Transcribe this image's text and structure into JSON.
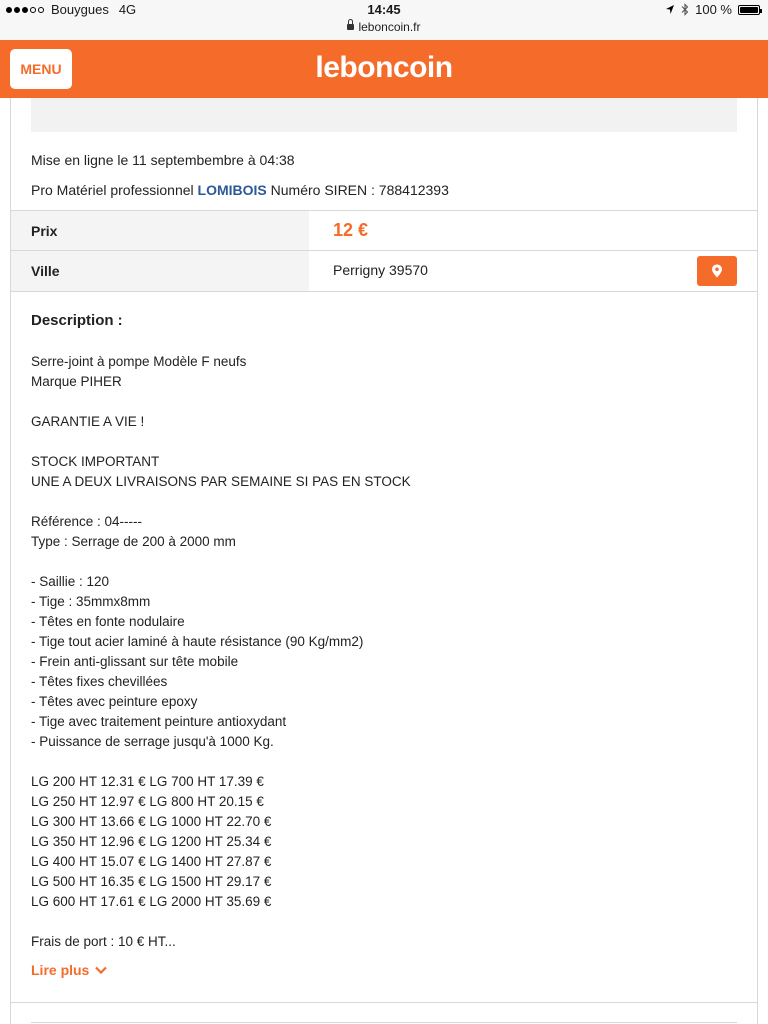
{
  "status_bar": {
    "carrier": "Bouygues",
    "network": "4G",
    "time": "14:45",
    "url": "leboncoin.fr",
    "battery": "100 %"
  },
  "header": {
    "menu_label": "MENU",
    "logo_text": "leboncoin"
  },
  "listing": {
    "posted": "Mise en ligne le 11 septembembre à 04:38",
    "seller_prefix": "Pro Matériel professionnel",
    "seller_name": "LOMIBOIS",
    "siren": "Numéro SIREN : 788412393",
    "price_label": "Prix",
    "price_value": "12 €",
    "city_label": "Ville",
    "city_value": "Perrigny 39570",
    "description_title": "Description :",
    "description_lines": [
      "Serre-joint à pompe Modèle F neufs",
      "Marque PIHER",
      "",
      "GARANTIE A VIE !",
      "",
      "STOCK IMPORTANT",
      "UNE A DEUX LIVRAISONS PAR SEMAINE SI PAS EN STOCK",
      "",
      "Référence : 04-----",
      "Type : Serrage de 200 à 2000 mm",
      "",
      "- Saillie : 120",
      "- Tige : 35mmx8mm",
      "- Têtes en fonte nodulaire",
      "- Tige tout acier laminé à haute résistance (90 Kg/mm2)",
      "- Frein anti-glissant sur tête mobile",
      "- Têtes fixes chevillées",
      "- Têtes avec peinture epoxy",
      "- Tige avec traitement peinture antioxydant",
      "- Puissance de serrage jusqu'à 1000 Kg.",
      "",
      "LG 200 HT 12.31 € LG 700 HT 17.39 €",
      "LG 250 HT 12.97 € LG 800 HT 20.15 €",
      "LG 300 HT 13.66 € LG 1000 HT 22.70 €",
      "LG 350 HT 12.96 € LG 1200 HT 25.34 €",
      "LG 400 HT 15.07 € LG 1400 HT 27.87 €",
      "LG 500 HT 16.35 € LG 1500 HT 29.17 €",
      "LG 600 HT 17.61 € LG 2000 HT 35.69 €",
      "",
      "Frais de port : 10 € HT..."
    ],
    "read_more": "Lire plus"
  },
  "colors": {
    "brand_orange": "#f56b2a",
    "link_blue": "#2b5a95"
  },
  "icons": [
    "location-arrow-icon",
    "bluetooth-icon",
    "battery-icon",
    "lock-icon",
    "map-pin-icon",
    "chevron-down-icon"
  ]
}
